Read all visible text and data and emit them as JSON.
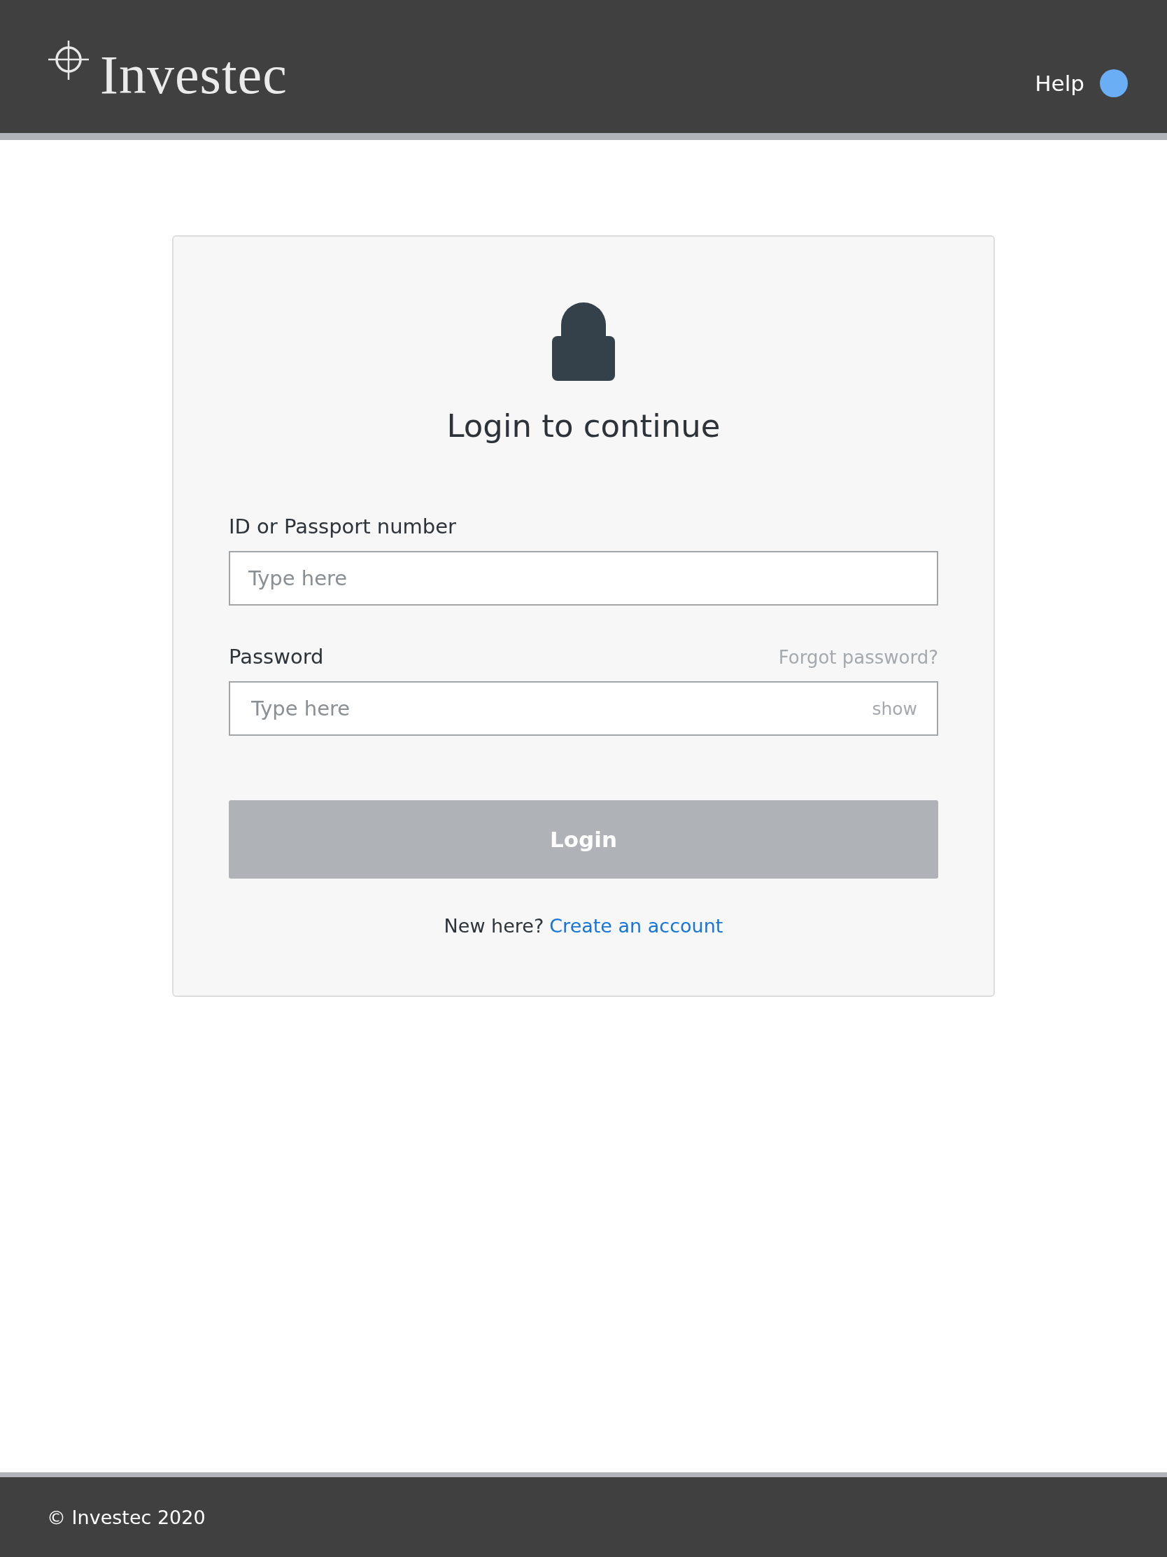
{
  "header": {
    "logo": "Investec",
    "help": "Help"
  },
  "login": {
    "title": "Login to continue",
    "fields": [
      {
        "kind": "text",
        "label": "ID or Passport number",
        "placeholder": "Type here"
      },
      {
        "kind": "password",
        "label": "Password",
        "link": "Forgot password?",
        "placeholder": "Type here",
        "toggle": "show"
      }
    ],
    "button": {
      "label": "Login",
      "disabled": true
    },
    "signup": {
      "prompt": "New here?",
      "link": "Create an account"
    }
  },
  "footer": {
    "copyright": "© Investec 2020"
  }
}
